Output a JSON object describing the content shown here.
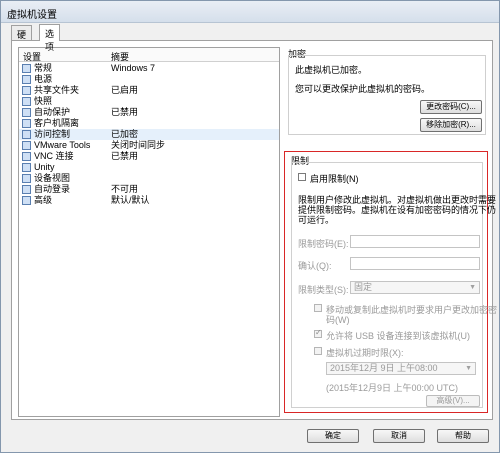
{
  "window": {
    "title": "虚拟机设置"
  },
  "tabs": [
    {
      "label": "硬件",
      "active": false
    },
    {
      "label": "选项",
      "active": true
    }
  ],
  "list": {
    "col_setting": "设置",
    "col_summary": "摘要",
    "items": [
      {
        "label": "常规",
        "value": "Windows 7",
        "icon": "general-icon"
      },
      {
        "label": "电源",
        "value": "",
        "icon": "power-icon"
      },
      {
        "label": "共享文件夹",
        "value": "已启用",
        "icon": "shared-folders-icon"
      },
      {
        "label": "快照",
        "value": "",
        "icon": "snapshot-icon"
      },
      {
        "label": "自动保护",
        "value": "已禁用",
        "icon": "autoprotect-icon"
      },
      {
        "label": "客户机隔离",
        "value": "",
        "icon": "guest-isolation-icon"
      },
      {
        "label": "访问控制",
        "value": "已加密",
        "icon": "access-control-icon",
        "selected": true
      },
      {
        "label": "VMware Tools",
        "value": "关闭时间同步",
        "icon": "vmware-tools-icon"
      },
      {
        "label": "VNC 连接",
        "value": "已禁用",
        "icon": "vnc-icon"
      },
      {
        "label": "Unity",
        "value": "",
        "icon": "unity-icon"
      },
      {
        "label": "设备视图",
        "value": "",
        "icon": "device-view-icon"
      },
      {
        "label": "自动登录",
        "value": "不可用",
        "icon": "autologin-icon"
      },
      {
        "label": "高级",
        "value": "默认/默认",
        "icon": "advanced-icon"
      }
    ]
  },
  "encryption": {
    "title": "加密",
    "status": "此虚拟机已加密。",
    "hint": "您可以更改保护此虚拟机的密码。",
    "change_btn": "更改密码(C)...",
    "remove_btn": "移除加密(R)..."
  },
  "restrictions": {
    "title": "限制",
    "enable_label": "启用限制(N)",
    "desc1": "限制用户修改此虚拟机。对虚拟机做出更改时需要",
    "desc2": "提供限制密码。虚拟机在设有加密密码的情况下仍",
    "desc3": "可运行。",
    "pwd_label": "限制密码(E):",
    "confirm_label": "确认(Q):",
    "type_label": "限制类型(S):",
    "type_value": "固定",
    "opt1_line1": "移动或复制此虚拟机时要求用户更改加密密",
    "opt1_line2": "码(W)",
    "opt2": "允许将 USB 设备连接到该虚拟机(U)",
    "opt3": "虚拟机过期时限(X):",
    "date_value": "2015年12月  9日 上午08:00",
    "date_note": "(2015年12月9日 上午00:00 UTC)",
    "advanced_btn": "高级(V)..."
  },
  "footer": {
    "ok": "确定",
    "cancel": "取消",
    "help": "帮助"
  }
}
